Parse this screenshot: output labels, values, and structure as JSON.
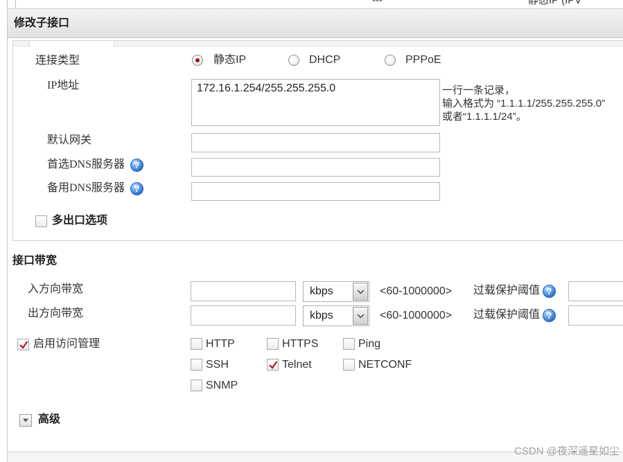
{
  "background_table": {
    "cell_dash": "---",
    "cell_type": "静态IP (IPV"
  },
  "dialog": {
    "title": "修改子接口",
    "connection_type": {
      "label": "连接类型",
      "options": [
        {
          "label": "静态IP",
          "selected": true
        },
        {
          "label": "DHCP",
          "selected": false
        },
        {
          "label": "PPPoE",
          "selected": false
        }
      ]
    },
    "ip_address": {
      "label": "IP地址",
      "value": "172.16.1.254/255.255.255.0",
      "hint": [
        "一行一条记录，",
        "输入格式为 “1.1.1.1/255.255.255.0”",
        "或者“1.1.1.1/24”。"
      ]
    },
    "default_gateway": {
      "label": "默认网关",
      "value": ""
    },
    "primary_dns": {
      "label": "首选DNS服务器",
      "value": ""
    },
    "secondary_dns": {
      "label": "备用DNS服务器",
      "value": ""
    },
    "multi_exit": {
      "label": "多出口选项",
      "checked": false
    }
  },
  "bandwidth": {
    "title": "接口带宽",
    "inbound": {
      "label": "入方向带宽",
      "value": "",
      "unit": "kbps",
      "range": "<60-1000000>",
      "threshold_label": "过载保护阈值",
      "threshold_value": ""
    },
    "outbound": {
      "label": "出方向带宽",
      "value": "",
      "unit": "kbps",
      "range": "<60-1000000>",
      "threshold_label": "过载保护阈值",
      "threshold_value": ""
    }
  },
  "access_management": {
    "label": "启用访问管理",
    "checked": true,
    "protocols": [
      {
        "label": "HTTP",
        "checked": false
      },
      {
        "label": "HTTPS",
        "checked": false
      },
      {
        "label": "Ping",
        "checked": false
      },
      {
        "label": "SSH",
        "checked": false
      },
      {
        "label": "Telnet",
        "checked": true
      },
      {
        "label": "NETCONF",
        "checked": false
      },
      {
        "label": "SNMP",
        "checked": false
      }
    ]
  },
  "advanced": {
    "label": "高级"
  },
  "watermark": "CSDN @夜深遥星如尘",
  "icons": {
    "help": "help-icon",
    "dropdown": "chevron-down-icon",
    "advanced_toggle": "triangle-down-icon",
    "check": "check-icon"
  },
  "colors": {
    "accent_red": "#a01818",
    "help_blue": "#2a6fd1",
    "title_bar": "#e8e8e8",
    "border": "#b9b9b9"
  }
}
